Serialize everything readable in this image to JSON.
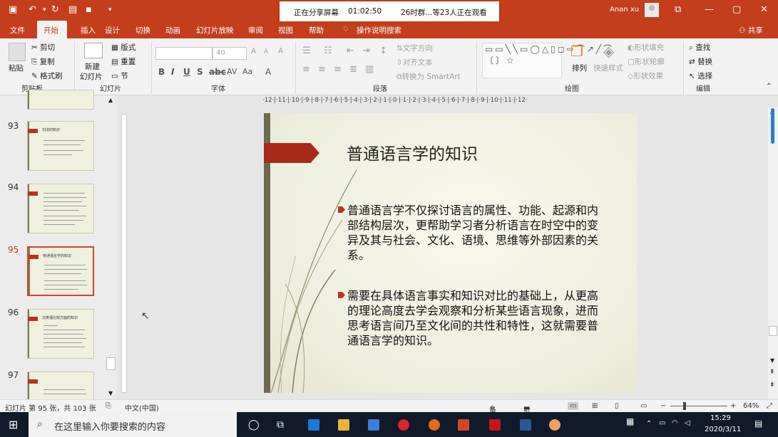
{
  "titlebar": {
    "share_status": "正在分享屏幕",
    "timer": "01:02:50",
    "viewers": "26时群...等23人正在观看",
    "user": "Anan xu"
  },
  "tabs": [
    "文件",
    "开始",
    "插入",
    "设计",
    "切换",
    "动画",
    "幻灯片放映",
    "审阅",
    "视图",
    "帮助",
    "操作说明搜索"
  ],
  "share_label": "共享",
  "ribbon": {
    "clipboard": {
      "paste": "粘贴",
      "cut": "剪切",
      "copy": "复制",
      "format_painter": "格式刷",
      "group": "剪贴板"
    },
    "slides": {
      "new_slide": "新建",
      "new_slide2": "幻灯片",
      "layout": "版式",
      "reset": "重置",
      "section": "节",
      "group": "幻灯片"
    },
    "font": {
      "font_size": "40",
      "group": "字体"
    },
    "paragraph": {
      "text_direction": "文字方向",
      "align_text": "对齐文本",
      "smartart": "转换为 SmartArt",
      "group": "段落"
    },
    "drawing": {
      "arrange": "排列",
      "quick_styles": "快速样式",
      "shape_fill": "形状填充",
      "shape_outline": "形状轮廓",
      "shape_effects": "形状效果",
      "group": "绘图"
    },
    "editing": {
      "find": "查找",
      "replace": "替换",
      "select": "选择",
      "group": "编辑"
    }
  },
  "ruler_top": "·12·|·11·|·10·|·9·|·8·|·7·|·6·|·5·|·4·|·3·|·2·|·1·|·0·|·1·|·2·|·3·|·4·|·5·|·6·|·7·|·8·|·9·|·10·|·11·|·12·",
  "thumbnails": [
    {
      "num": "93",
      "title": "句法的知识"
    },
    {
      "num": "94",
      "title": ""
    },
    {
      "num": "95",
      "title": "普通语言学的知识"
    },
    {
      "num": "96",
      "title": "汉英语比较方面的知识"
    },
    {
      "num": "97",
      "title": ""
    }
  ],
  "slide": {
    "title": "普通语言学的知识",
    "bullet1": "普通语言学不仅探讨语言的属性、功能、起源和内部结构层次，更帮助学习者分析语言在时空中的变异及其与社会、文化、语境、思维等外部因素的关系。",
    "bullet2": "需要在具体语言事实和知识对比的基础上，从更高的理论高度去学会观察和分析某些语言现象，进而思考语言间乃至文化间的共性和特性，这就需要普通语言学的知识。"
  },
  "status": {
    "slide_info": "幻灯片 第 95 张，共 103 张",
    "language": "中文(中国)",
    "notes": "备注",
    "comments": "批注",
    "zoom": "64%"
  },
  "taskbar": {
    "search_placeholder": "在这里输入你要搜索的内容",
    "time": "15:29",
    "date": "2020/3/11"
  },
  "colors": {
    "accent": "#c43e1c",
    "slide_accent": "#a82a18"
  }
}
